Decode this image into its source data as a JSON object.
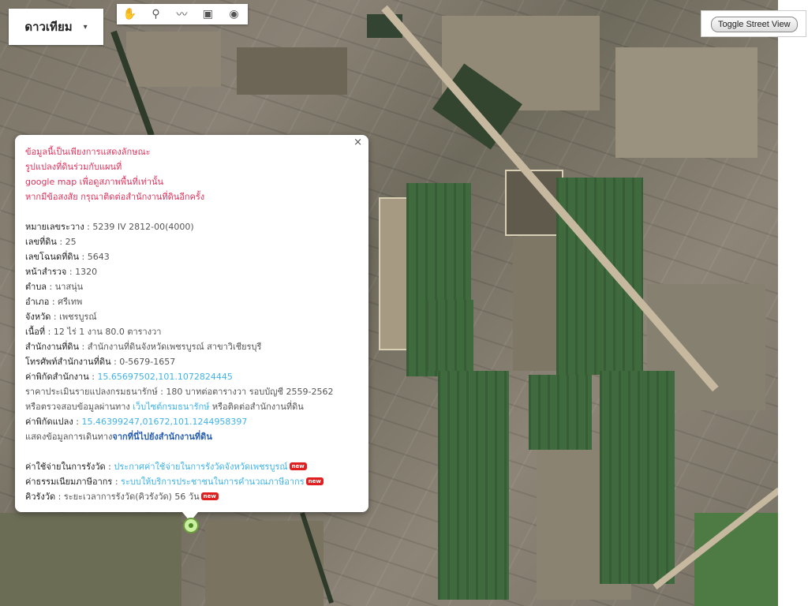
{
  "map_type": {
    "label": "ดาวเทียม",
    "arrow": "▾"
  },
  "draw_tools": [
    {
      "icon": "hand-icon",
      "glyph": "✋"
    },
    {
      "icon": "marker-icon",
      "glyph": "⚲"
    },
    {
      "icon": "polyline-icon",
      "glyph": "〰"
    },
    {
      "icon": "polygon-icon",
      "glyph": "▣"
    },
    {
      "icon": "circle-icon",
      "glyph": "◉"
    },
    {
      "icon": "rectangle-icon",
      "glyph": "⊳"
    }
  ],
  "street_view": {
    "label": "Toggle Street View"
  },
  "popup": {
    "close": "×",
    "notice": [
      "ข้อมูลนี้เป็นเพียงการแสดงลักษณะ",
      "รูปแปลงที่ดินร่วมกับแผนที่",
      "google map เพื่อดูสภาพพื้นที่เท่านั้น",
      "หากมีข้อสงสัย กรุณาติดต่อสำนักงานที่ดินอีกครั้ง"
    ],
    "fields": [
      {
        "label": "หมายเลขระวาง",
        "value": " : 5239 IV 2812-00(4000)"
      },
      {
        "label": "เลขที่ดิน",
        "value": " : 25"
      },
      {
        "label": "เลขโฉนดที่ดิน",
        "value": " : 5643"
      },
      {
        "label": "หน้าสำรวจ",
        "value": " : 1320"
      },
      {
        "label": "ตำบล",
        "value": " : นาสนุ่น"
      },
      {
        "label": "อำเภอ",
        "value": " : ศรีเทพ"
      },
      {
        "label": "จังหวัด",
        "value": " : เพชรบูรณ์"
      },
      {
        "label": "เนื้อที่",
        "value": " : 12 ไร่ 1 งาน 80.0 ตารางวา"
      },
      {
        "label": "สำนักงานที่ดิน",
        "value": " : สำนักงานที่ดินจังหวัดเพชรบูรณ์ สาขาวิเชียรบุรี"
      },
      {
        "label": "โทรศัพท์สำนักงานที่ดิน",
        "value": " : 0-5679-1657"
      }
    ],
    "office_coord": {
      "label": "ค่าพิกัดสำนักงาน",
      "value": "15.65697502,101.1072824445"
    },
    "appraisal": "ราคาประเมินรายแปลงกรมธนารักษ์ : 180 บาทต่อตารางวา รอบบัญชี 2559-2562",
    "check_prefix": "หรือตรวจสอบข้อมูลผ่านทาง ",
    "check_link": "เว็บไซต์กรมธนารักษ์",
    "check_suffix": " หรือติดต่อสำนักงานที่ดิน",
    "parcel_coord": {
      "label": "ค่าพิกัดแปลง",
      "value": "15.46399247,01672,101.1244958397"
    },
    "route_prefix": "แสดงข้อมูลการเดินทาง",
    "route_link": "จากที่นี่ไปยังสำนักงานที่ดิน",
    "fee": {
      "label": "ค่าใช้จ่ายในการรังวัด",
      "link": "ประกาศค่าใช้จ่ายในการรังวัดจังหวัดเพชรบูรณ์"
    },
    "tax": {
      "label": "ค่าธรรมเนียมภาษีอากร",
      "link": "ระบบให้บริการประชาชนในการคำนวณภาษีอากร"
    },
    "queue": {
      "label": "คิวรังวัด",
      "value": " : ระยะเวลาการรังวัด(คิวรังวัด) 56 วัน"
    },
    "new_badge": "new"
  },
  "colors": {
    "notice": "#e0315b",
    "link": "#3fb3e8",
    "bold_link": "#2a5fb0",
    "new_badge": "#e02020"
  }
}
